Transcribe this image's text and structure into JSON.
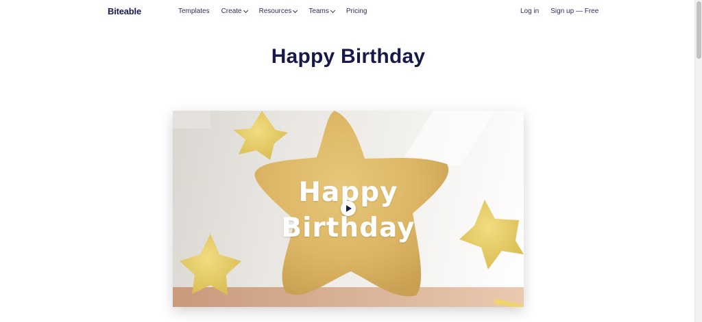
{
  "header": {
    "logo": "Biteable",
    "nav": [
      {
        "label": "Templates",
        "has_dropdown": false
      },
      {
        "label": "Create",
        "has_dropdown": true
      },
      {
        "label": "Resources",
        "has_dropdown": true
      },
      {
        "label": "Teams",
        "has_dropdown": true
      },
      {
        "label": "Pricing",
        "has_dropdown": false
      }
    ],
    "login_label": "Log in",
    "signup_label": "Sign up — Free"
  },
  "main": {
    "title": "Happy Birthday",
    "video": {
      "overlay_line1": "Happy",
      "overlay_line2": "Birthday",
      "play_icon": "play-icon"
    }
  },
  "colors": {
    "brand_navy": "#17194a",
    "star_yellow": "#e8c86a",
    "background": "#ffffff"
  }
}
